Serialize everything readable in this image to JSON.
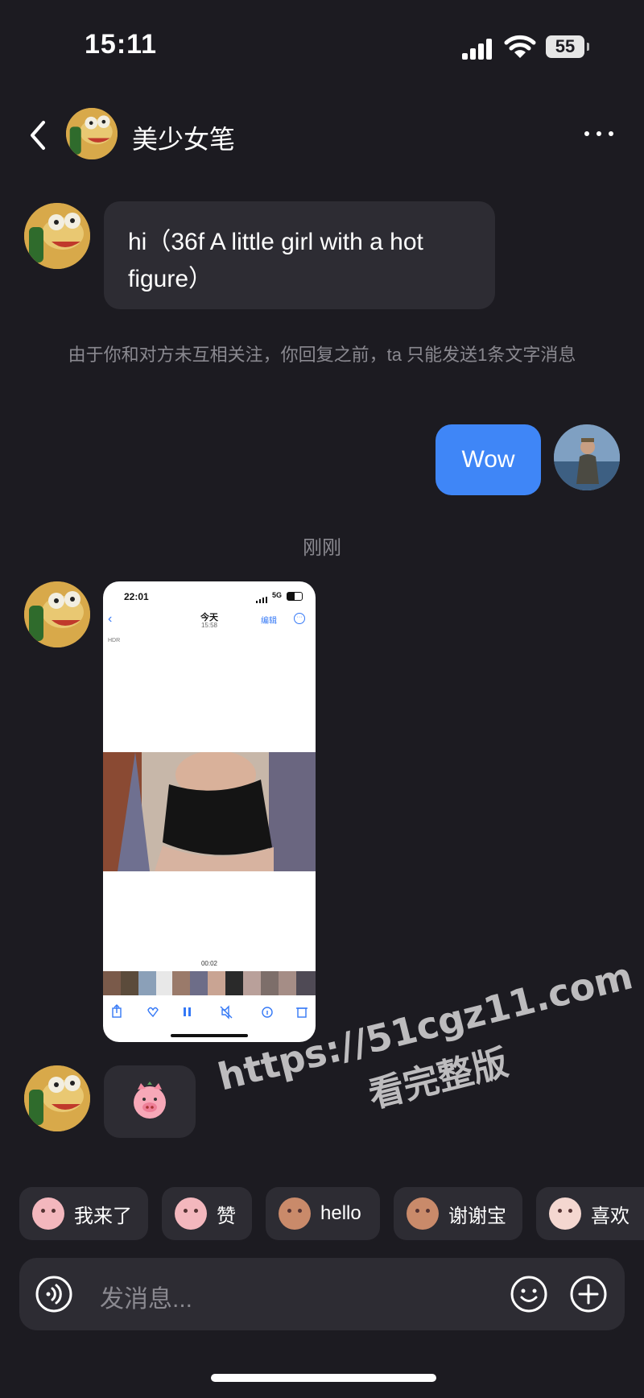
{
  "status_bar": {
    "time": "15:11",
    "battery": "55"
  },
  "header": {
    "title": "美少女笔"
  },
  "messages": {
    "first": "hi（36f A little girl with a hot figure）",
    "notice": "由于你和对方未互相关注，你回复之前，ta 只能发送1条文字消息",
    "reply": "Wow",
    "timestamp": "刚刚"
  },
  "screenshot": {
    "time": "22:01",
    "network": "5G",
    "title": "今天",
    "subtitle": "15:58",
    "edit": "编辑",
    "hdr": "HDR",
    "duration": "00:02"
  },
  "quick_replies": [
    {
      "label": "我来了"
    },
    {
      "label": "赞"
    },
    {
      "label": "hello"
    },
    {
      "label": "谢谢宝"
    },
    {
      "label": "喜欢"
    }
  ],
  "input": {
    "placeholder": "发消息..."
  },
  "watermark": {
    "url": "https://51cgz11.com",
    "caption": "看完整版"
  },
  "colors": {
    "background": "#1c1b21",
    "bubble_in": "#2d2c33",
    "bubble_out": "#3f86f7",
    "muted_text": "#8a8990"
  },
  "icons": [
    "back-icon",
    "more-icon",
    "voice-icon",
    "emoji-icon",
    "plus-icon",
    "signal-icon",
    "wifi-icon",
    "battery-icon"
  ]
}
